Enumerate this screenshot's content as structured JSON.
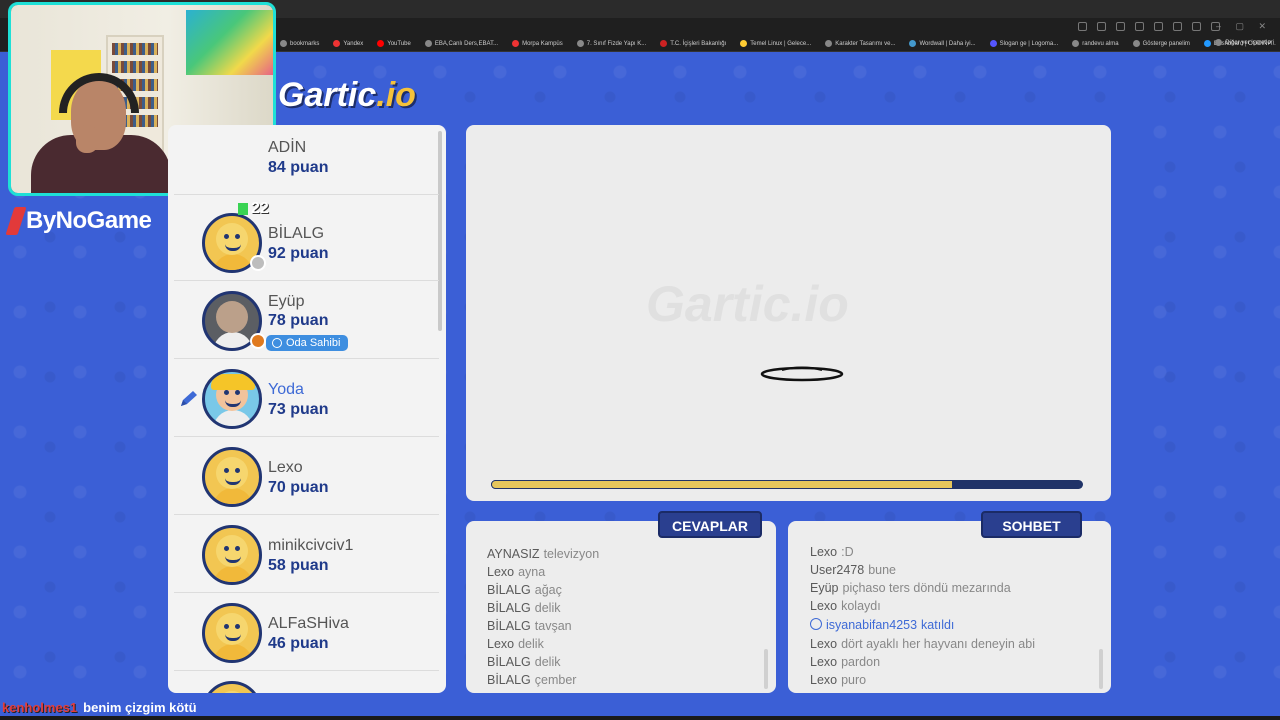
{
  "browser": {
    "bookmarks": [
      "bookmarks",
      "Yandex",
      "YouTube",
      "EBA,Canlı Ders,EBAT...",
      "Morpa Kampüs",
      "7. Sınıf Fizde Yapı K...",
      "T.C. İçişleri Bakanlığı",
      "Temel Linux | Gelece...",
      "Karakter Tasarımı ve...",
      "Wordwall | Daha iyi...",
      "Slogan ge | Logoma...",
      "randevu alma",
      "Gösterge panelim",
      "Dashboard | CODINP..."
    ],
    "bookmarks_right": "Diğer yer işaretleri"
  },
  "sponsor": "ByNoGame",
  "logo": {
    "text_a": "Gartic",
    "text_b": ".io"
  },
  "player_count": "22",
  "players": [
    {
      "name": "ADİN",
      "score": "84 puan"
    },
    {
      "name": "BİLALG",
      "score": "92 puan"
    },
    {
      "name": "Eyüp",
      "score": "78 puan",
      "badge": "Oda Sahibi"
    },
    {
      "name": "Yoda",
      "score": "73 puan"
    },
    {
      "name": "Lexo",
      "score": "70 puan"
    },
    {
      "name": "minikcivciv1",
      "score": "58 puan"
    },
    {
      "name": "ALFaSHiva",
      "score": "46 puan"
    }
  ],
  "canvas": {
    "watermark": "Gartic.io",
    "timer_fraction": 0.78
  },
  "tabs": {
    "answers": "CEVAPLAR",
    "chat": "SOHBET"
  },
  "answers": [
    {
      "who": "AYNASIZ",
      "text": "televizyon"
    },
    {
      "who": "Lexo",
      "text": "ayna"
    },
    {
      "who": "BİLALG",
      "text": "ağaç"
    },
    {
      "who": "BİLALG",
      "text": "delik"
    },
    {
      "who": "BİLALG",
      "text": "tavşan"
    },
    {
      "who": "Lexo",
      "text": "delik"
    },
    {
      "who": "BİLALG",
      "text": "delik"
    },
    {
      "who": "BİLALG",
      "text": "çember"
    }
  ],
  "chat": [
    {
      "who": "Lexo",
      "text": ":D"
    },
    {
      "who": "User2478",
      "text": "bune"
    },
    {
      "who": "Eyüp",
      "text": "piçhaso ters döndü mezarında"
    },
    {
      "who": "Lexo",
      "text": "kolaydı"
    },
    {
      "who": "isyanabifan4253",
      "text": "katıldı",
      "system": true
    },
    {
      "who": "Lexo",
      "text": "dört ayaklı her hayvanı deneyin abi"
    },
    {
      "who": "Lexo",
      "text": "pardon"
    },
    {
      "who": "Lexo",
      "text": "puro"
    }
  ],
  "ticker": {
    "user": "kenholmes1",
    "message": "benim çizgim kötü"
  },
  "colors": {
    "background": "#3b5fd6",
    "accent": "#1f3a8a",
    "timer": "#e6c65c",
    "webcam_border": "#1ee0d6"
  }
}
